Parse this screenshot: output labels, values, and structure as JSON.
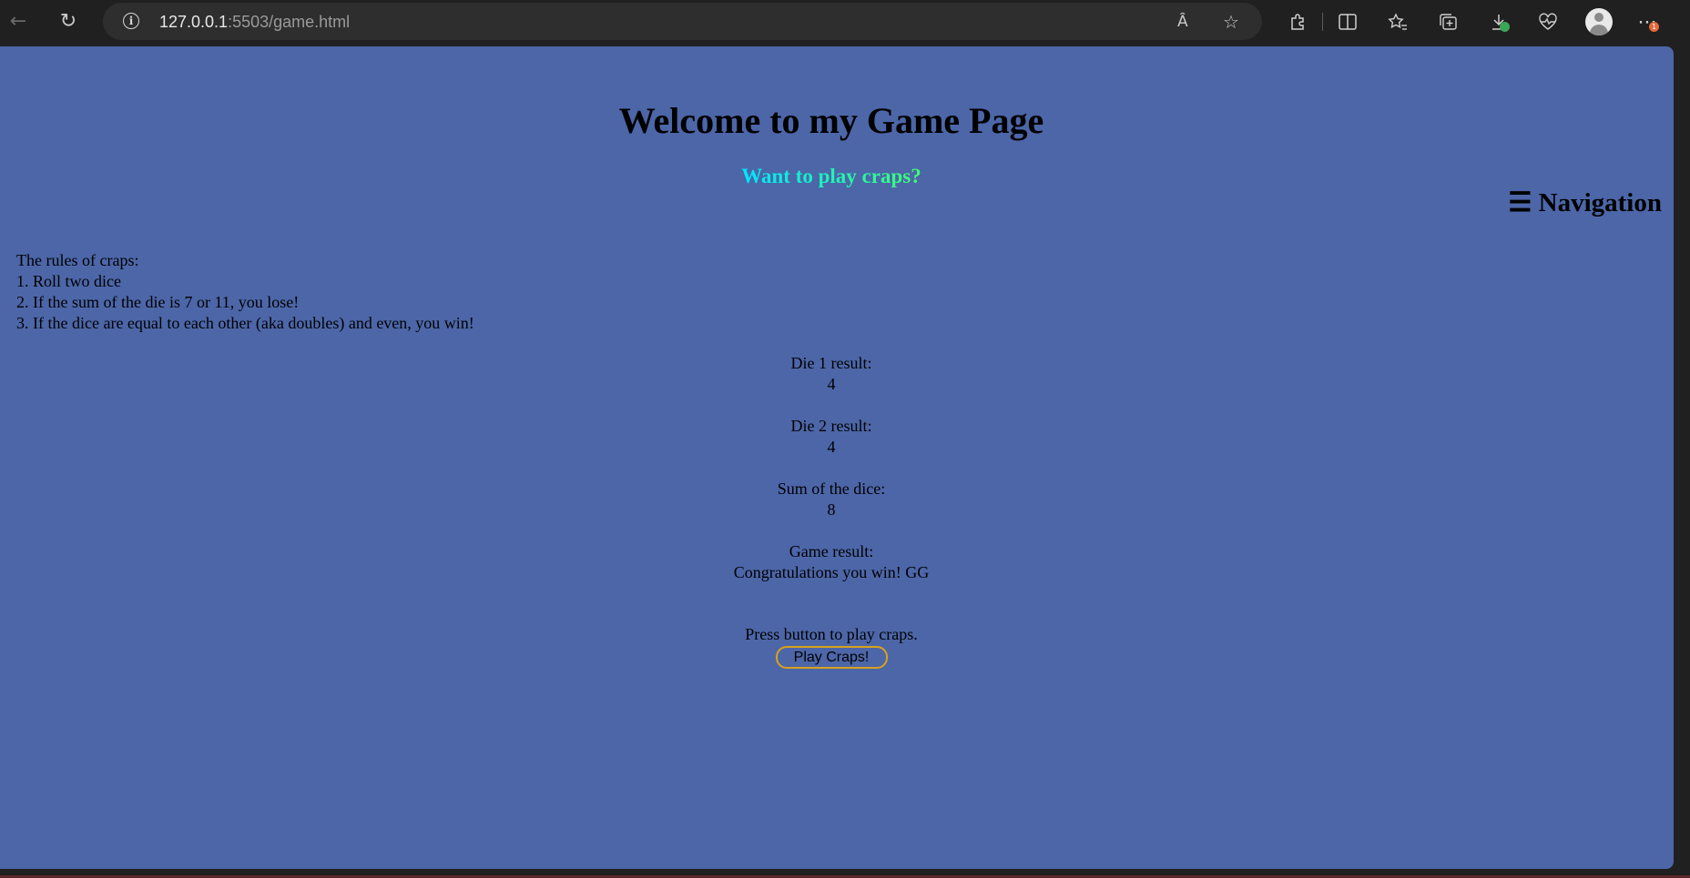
{
  "browser": {
    "url_host": "127.0.0.1",
    "url_path": ":5503/game.html",
    "icons": {
      "back": "back-arrow-icon",
      "reload": "reload-icon",
      "info": "info-icon",
      "read_aloud": "read-aloud-icon",
      "favorite": "star-icon",
      "extensions": "puzzle-icon",
      "split_screen": "split-screen-icon",
      "favorites": "favorites-icon",
      "collections": "collections-icon",
      "downloads": "download-icon",
      "health": "heart-pulse-icon",
      "profile": "profile-avatar",
      "menu": "ellipsis-icon"
    },
    "info_glyph": "i",
    "read_aloud_glyph": "Ȃ",
    "menu_badge": "1"
  },
  "page": {
    "title": "Welcome to my Game Page",
    "subtitle": "Want to play craps?",
    "nav_toggle": "☰ Navigation",
    "rules": {
      "heading": "The rules of craps:",
      "items": [
        "1. Roll two dice",
        "2. If the sum of the die is 7 or 11, you lose!",
        "3. If the dice are equal to each other (aka doubles) and even, you win!"
      ]
    },
    "results": {
      "die1_label": "Die 1 result:",
      "die1_value": "4",
      "die2_label": "Die 2 result:",
      "die2_value": "4",
      "sum_label": "Sum of the dice:",
      "sum_value": "8",
      "game_label": "Game result:",
      "game_value": "Congratulations you win! GG"
    },
    "prompt": "Press button to play craps.",
    "play_button": "Play Craps!"
  },
  "colors": {
    "page_background": "#4c66a8",
    "subtitle_gradient_start": "#00e5ff",
    "subtitle_gradient_end": "#40ff70",
    "button_border": "#d8a21c",
    "browser_chrome": "#202020"
  }
}
